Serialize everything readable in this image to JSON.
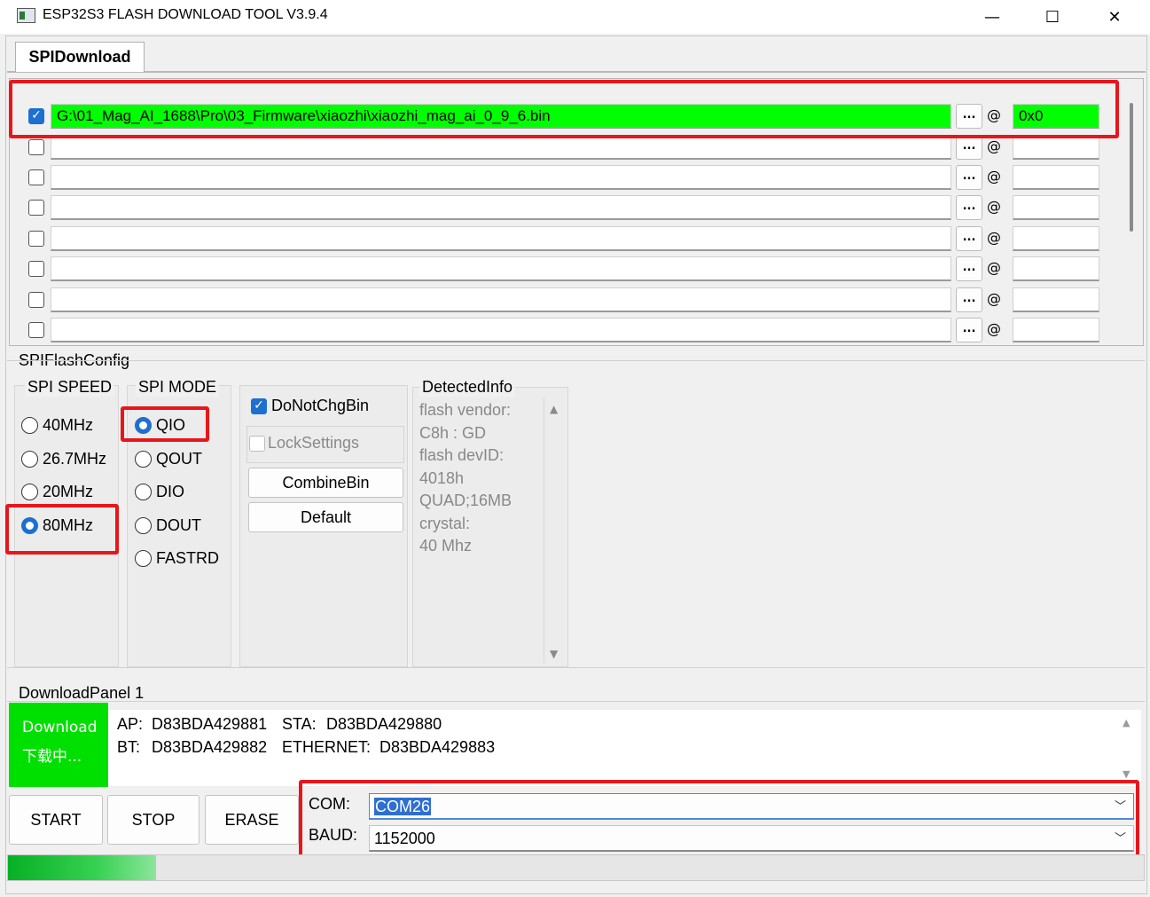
{
  "window": {
    "title": "ESP32S3 FLASH DOWNLOAD TOOL V3.9.4",
    "minimize": "—",
    "maximize": "☐",
    "close": "✕"
  },
  "tabs": [
    {
      "label": "SPIDownload",
      "active": true
    }
  ],
  "files": [
    {
      "checked": true,
      "path": "G:\\01_Mag_AI_1688\\Pro\\03_Firmware\\xiaozhi\\xiaozhi_mag_ai_0_9_6.bin",
      "address": "0x0"
    },
    {
      "checked": false,
      "path": "",
      "address": ""
    },
    {
      "checked": false,
      "path": "",
      "address": ""
    },
    {
      "checked": false,
      "path": "",
      "address": ""
    },
    {
      "checked": false,
      "path": "",
      "address": ""
    },
    {
      "checked": false,
      "path": "",
      "address": ""
    },
    {
      "checked": false,
      "path": "",
      "address": ""
    },
    {
      "checked": false,
      "path": "",
      "address": ""
    }
  ],
  "browse_label": "...",
  "at_label": "@",
  "spi_flash_config": {
    "title": "SPIFlashConfig",
    "spi_speed": {
      "title": "SPI SPEED",
      "options": [
        "40MHz",
        "26.7MHz",
        "20MHz",
        "80MHz"
      ],
      "selected": "80MHz"
    },
    "spi_mode": {
      "title": "SPI MODE",
      "options": [
        "QIO",
        "QOUT",
        "DIO",
        "DOUT",
        "FASTRD"
      ],
      "selected": "QIO"
    },
    "do_not_chg_bin": {
      "label": "DoNotChgBin",
      "checked": true
    },
    "lock_settings": {
      "label": "LockSettings",
      "checked": false
    },
    "combine_bin": "CombineBin",
    "default": "Default",
    "detected_info": {
      "title": "DetectedInfo",
      "lines": [
        "flash vendor:",
        "C8h : GD",
        "flash devID:",
        "4018h",
        "QUAD;16MB",
        "crystal:",
        "40 Mhz"
      ]
    }
  },
  "download_panel": {
    "title": "DownloadPanel 1",
    "status_line1": "Download",
    "status_line2": "下载中...",
    "ap_label": "AP:",
    "ap_value": "D83BDA429881",
    "sta_label": "STA:",
    "sta_value": "D83BDA429880",
    "bt_label": "BT:",
    "bt_value": "D83BDA429882",
    "eth_label": "ETHERNET:",
    "eth_value": "D83BDA429883",
    "start": "START",
    "stop": "STOP",
    "erase": "ERASE",
    "com_label": "COM:",
    "com_value": "COM26",
    "baud_label": "BAUD:",
    "baud_value": "1152000",
    "progress": 0.13
  },
  "colors": {
    "highlight_green": "#00ff00",
    "accent_blue": "#1d6fd0",
    "annotation_red": "#e8161b"
  }
}
